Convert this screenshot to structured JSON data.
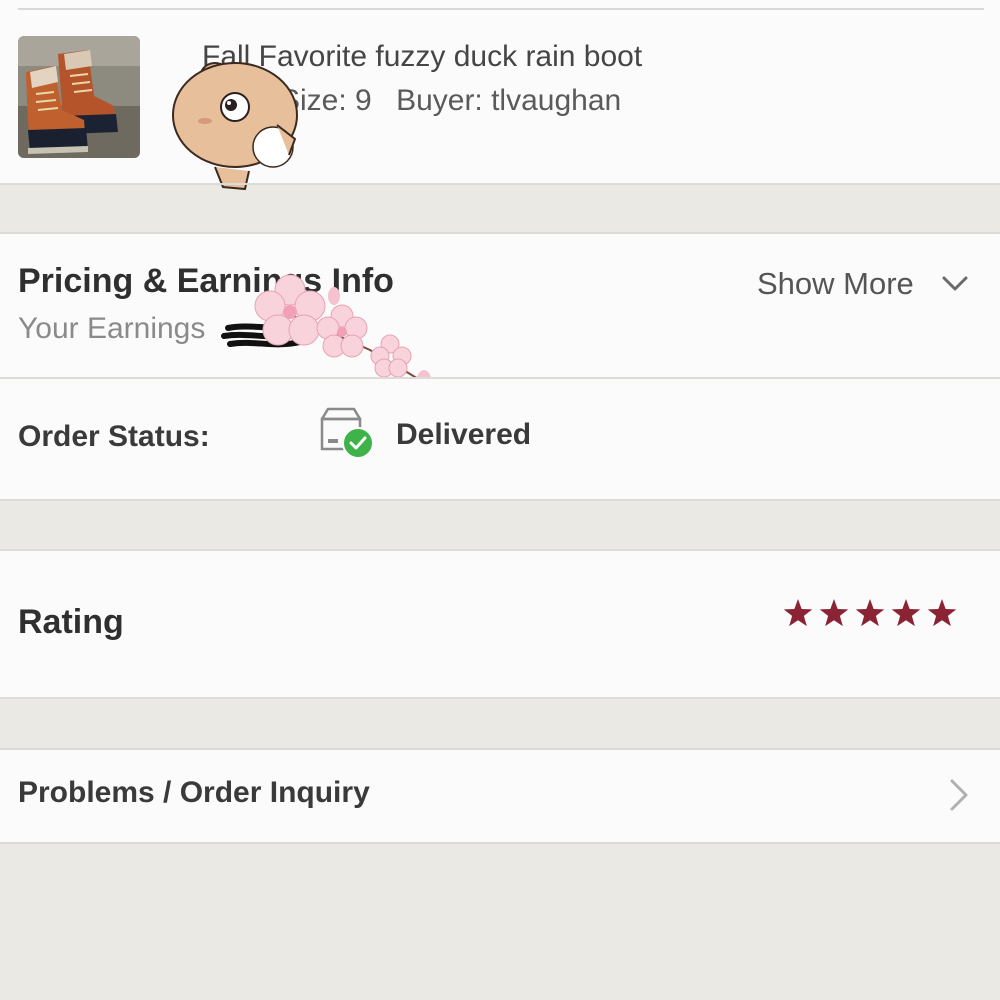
{
  "item": {
    "title": "Fall Favorite fuzzy duck rain boot",
    "size": "Size: 9",
    "buyer": "Buyer: tlvaughan",
    "thumbnail_icon": "rain-boots-photo"
  },
  "pricing": {
    "title": "Pricing & Earnings Info",
    "subtitle": "Your Earnings",
    "show_more": "Show More"
  },
  "order_status": {
    "label": "Order Status:",
    "value": "Delivered",
    "icon": "package-delivered-icon",
    "check_color": "#3db34a"
  },
  "rating": {
    "label": "Rating",
    "stars": 5,
    "max_stars": 5,
    "star_color": "#8a2334"
  },
  "problems": {
    "label": "Problems / Order Inquiry"
  },
  "colors": {
    "panel": "#fbfbfc",
    "background": "#ebe9e4",
    "text": "#333333",
    "muted": "#8a8a8a"
  }
}
